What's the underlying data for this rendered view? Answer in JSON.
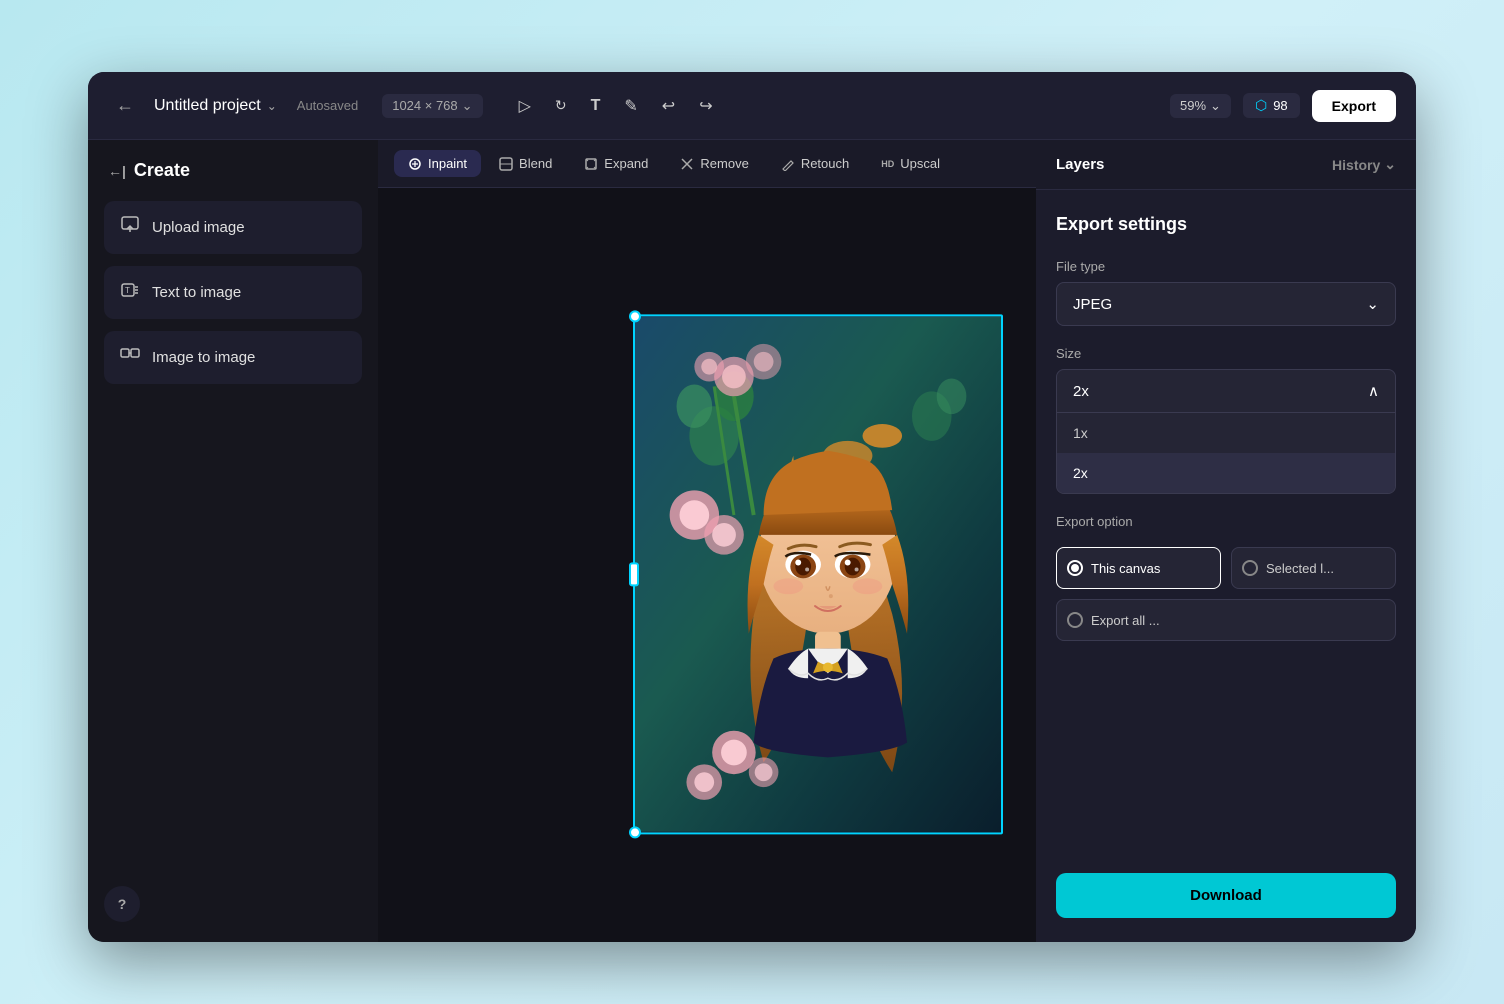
{
  "app": {
    "title": "Untitled project",
    "autosaved": "Autosaved",
    "canvas_size": "1024 × 768",
    "zoom": "59%",
    "credits": "98",
    "export_btn": "Export"
  },
  "header": {
    "back_icon": "←",
    "chevron_icon": "⌄",
    "canvas_size_chevron": "⌄",
    "zoom_chevron": "⌄"
  },
  "tools": [
    {
      "name": "select",
      "icon": "▷"
    },
    {
      "name": "rotate",
      "icon": "↻"
    },
    {
      "name": "text",
      "icon": "T"
    },
    {
      "name": "pen",
      "icon": "✏"
    },
    {
      "name": "undo",
      "icon": "↩"
    },
    {
      "name": "redo",
      "icon": "↪"
    }
  ],
  "sidebar": {
    "create_label": "Create",
    "back_icon": "←",
    "items": [
      {
        "id": "upload",
        "icon": "⬆",
        "label": "Upload image"
      },
      {
        "id": "text-to-image",
        "icon": "⇧",
        "label": "Text to image"
      },
      {
        "id": "image-to-image",
        "icon": "⊞",
        "label": "Image to image"
      }
    ],
    "help_label": "?"
  },
  "toolbar": {
    "buttons": [
      {
        "id": "inpaint",
        "icon": "✦",
        "label": "Inpaint",
        "active": true
      },
      {
        "id": "blend",
        "icon": "⊡",
        "label": "Blend",
        "active": false
      },
      {
        "id": "expand",
        "icon": "⊡",
        "label": "Expand",
        "active": false
      },
      {
        "id": "remove",
        "icon": "◇",
        "label": "Remove",
        "active": false
      },
      {
        "id": "retouch",
        "icon": "✦",
        "label": "Retouch",
        "active": false
      },
      {
        "id": "upscal",
        "icon": "HD",
        "label": "Upscal",
        "active": false
      }
    ]
  },
  "right_panel": {
    "layers_tab": "Layers",
    "history_tab": "History",
    "history_chevron": "⌄"
  },
  "export_settings": {
    "title": "Export settings",
    "file_type_label": "File type",
    "file_type_value": "JPEG",
    "file_type_chevron": "⌄",
    "size_label": "Size",
    "size_value": "2x",
    "size_chevron": "∧",
    "size_options": [
      {
        "id": "1x",
        "label": "1x"
      },
      {
        "id": "2x",
        "label": "2x",
        "selected": true
      }
    ],
    "export_option_label": "Export option",
    "options": [
      {
        "id": "this-canvas",
        "label": "This canvas",
        "selected": true
      },
      {
        "id": "selected",
        "label": "Selected l...",
        "selected": false
      }
    ],
    "export_all_label": "Export all ...",
    "download_label": "Download"
  }
}
